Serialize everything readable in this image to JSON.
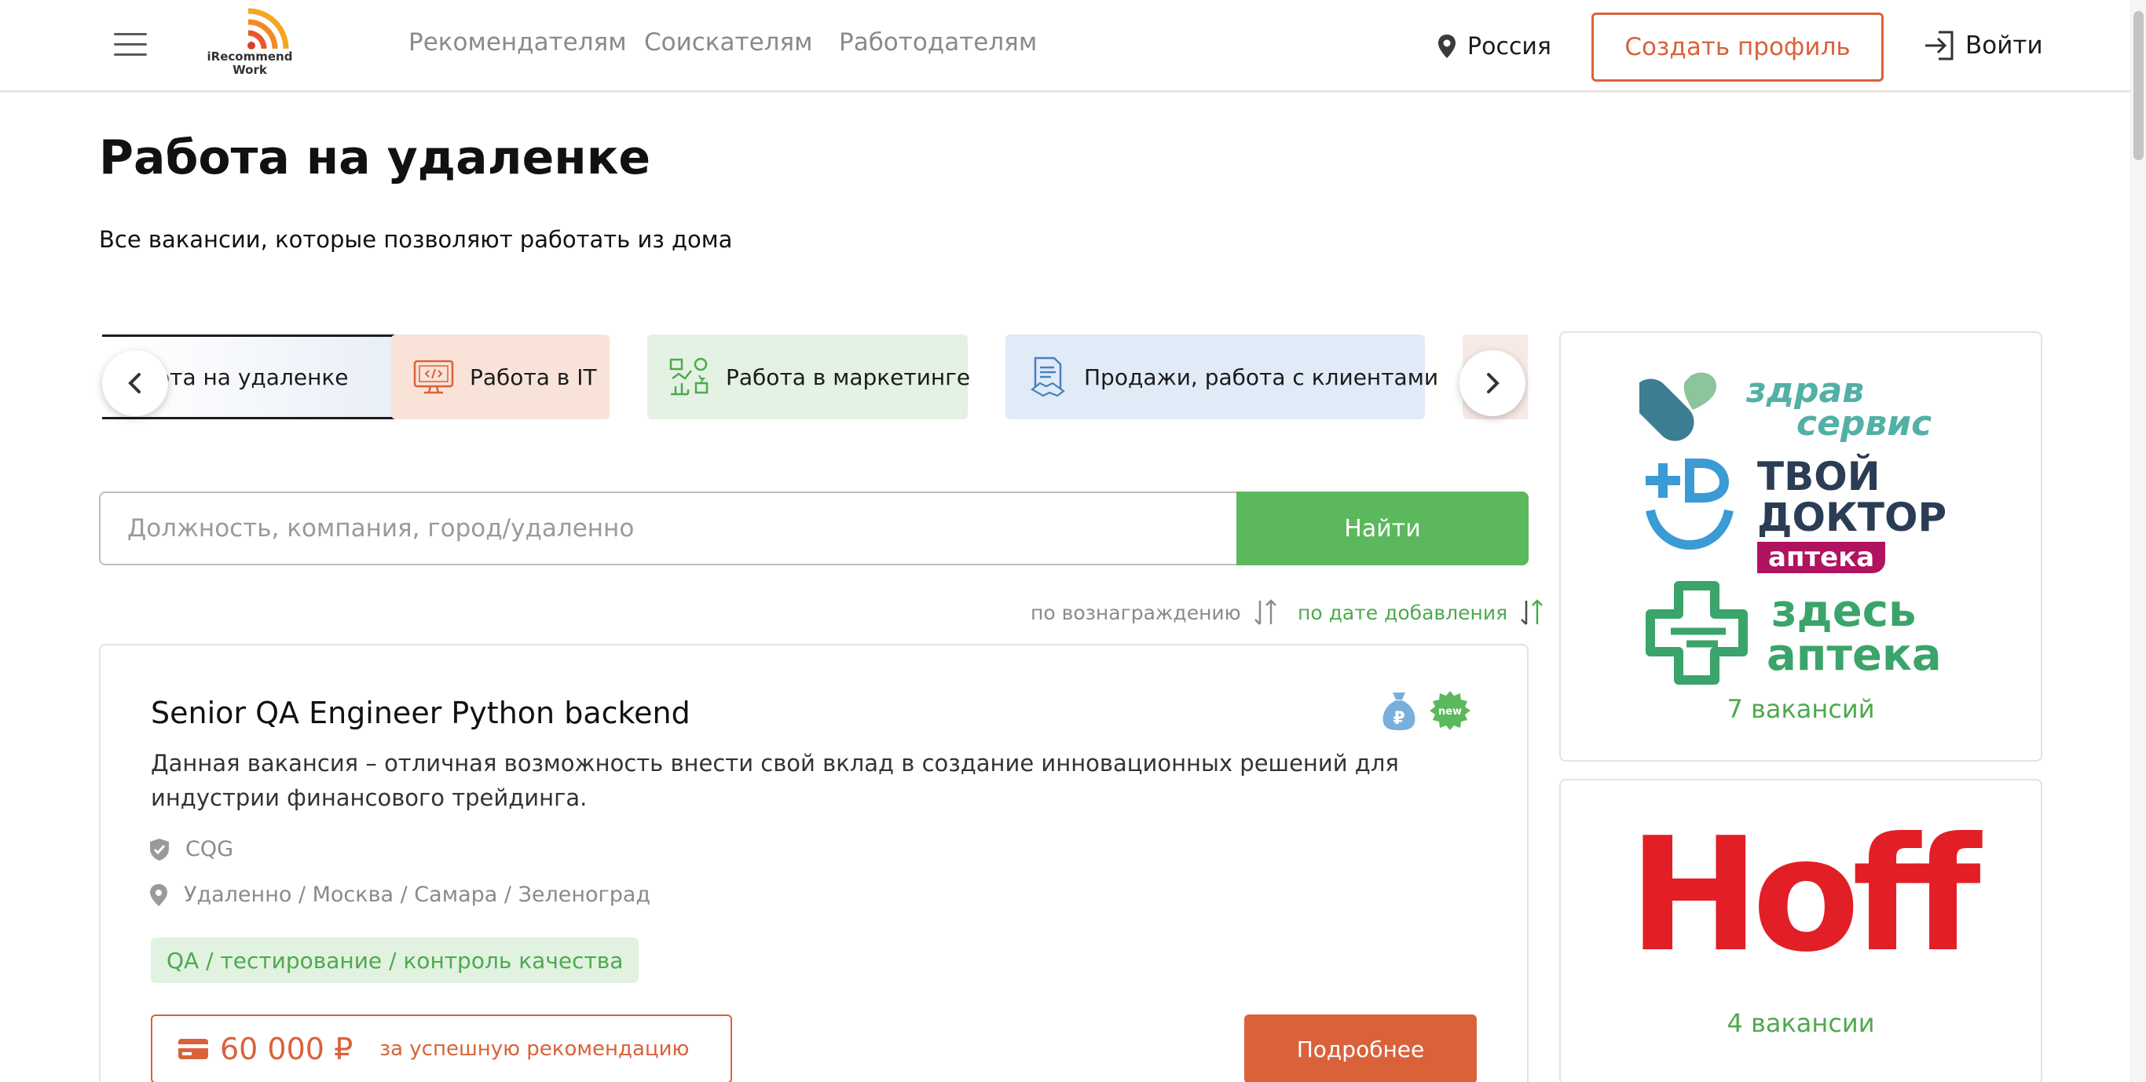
{
  "header": {
    "logo_line1": "iRecommend",
    "logo_line2": "Work",
    "nav": [
      {
        "label": "Рекомендателям"
      },
      {
        "label": "Соискателям"
      },
      {
        "label": "Работодателям"
      }
    ],
    "region": "Россия",
    "create_profile": "Создать профиль",
    "login": "Войти"
  },
  "page": {
    "title": "Работа на удаленке",
    "subtitle": "Все вакансии, которые позволяют работать из дома"
  },
  "categories": [
    {
      "label": "Работа на удаленке",
      "visible_label": "ота на удаленке",
      "icon": "remote-icon",
      "active": true
    },
    {
      "label": "Работа в IT",
      "icon": "computer-code-icon",
      "color": "#f9e3d8"
    },
    {
      "label": "Работа в маркетинге",
      "icon": "marketing-icon",
      "color": "#e3f2e3"
    },
    {
      "label": "Продажи, работа с клиентами",
      "icon": "sales-document-icon",
      "color": "#e0ebf7"
    }
  ],
  "search": {
    "placeholder": "Должность, компания, город/удаленно",
    "button": "Найти"
  },
  "sort": {
    "by_reward": "по вознаграждению",
    "by_date": "по дате добавления",
    "active": "by_date"
  },
  "vacancy": {
    "title": "Senior QA Engineer Python backend",
    "description": "Данная вакансия – отличная возможность внести свой вклад в создание инновационных решений для индустрии финансового трейдинга.",
    "company": "CQG",
    "locations": "Удаленно / Москва / Самара / Зеленоград",
    "tag": "QA / тестирование / контроль качества",
    "reward_amount": "60 000",
    "currency": "₽",
    "reward_note": "за успешную рекомендацию",
    "more_button": "Подробнее",
    "badge_new": "new"
  },
  "employers": [
    {
      "brands": [
        {
          "line1": "здрав",
          "line2": "сервис"
        },
        {
          "line1": "ТВОЙ",
          "line2": "ДОКТОР",
          "line3": "аптека",
          "mark": "+D"
        },
        {
          "line1": "здесь",
          "line2": "аптека"
        }
      ],
      "count": "7 вакансий"
    },
    {
      "brands": [
        {
          "line1": "Hoff"
        }
      ],
      "count": "4 вакансии"
    }
  ],
  "colors": {
    "accent_orange": "#d9623b",
    "accent_green": "#5cb85c",
    "text_green": "#4ea94e",
    "hoff_red": "#e21f26",
    "zdrav_teal": "#3b7d92",
    "pharmacy_green": "#3aa46a",
    "doctor_navy": "#2b3d55",
    "doctor_magenta": "#b0135f"
  }
}
